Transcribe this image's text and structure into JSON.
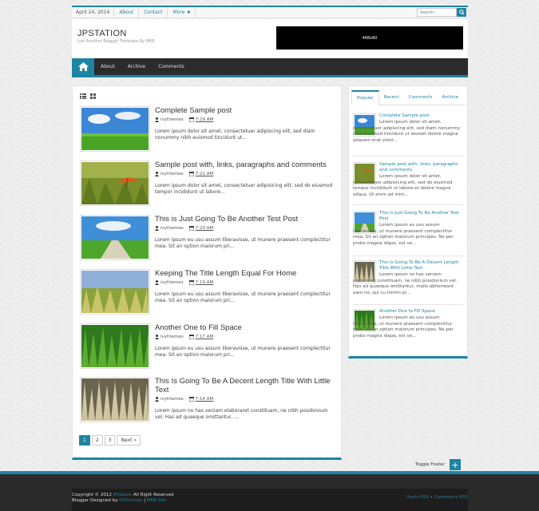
{
  "topbar": {
    "date": "April 24, 2014",
    "links": [
      "About",
      "Contact",
      "More"
    ],
    "search_placeholder": "Search..."
  },
  "header": {
    "logo": "JPSTATION",
    "tagline": "Just Another Blogger Template By MKR",
    "ad_label": "468x60"
  },
  "nav": {
    "items": [
      "About",
      "Archive",
      "Comments"
    ]
  },
  "posts": [
    {
      "title": "Complete Sample post",
      "author": "ivythemes",
      "time": "7:29 AM",
      "excerpt": "Lorem ipsum dolor sit amet, consectetuer adipiscing elit, sed diam nonummy nibh euismod tincidunt ut..."
    },
    {
      "title": "Sample post with, links, paragraphs and comments",
      "author": "ivythemes",
      "time": "7:21 AM",
      "excerpt": "Lorem ipsum dolor sit amet, consectetuer adipisicing elit, sed do eiusmod tempor incididunt ut labore..."
    },
    {
      "title": "This is Just Going To Be Another Test Post",
      "author": "ivythemes",
      "time": "7:20 AM",
      "excerpt": "Lorem ipsum eu usu assum liberavisse, ut munere praesent complectitur mea. Sit an option maiorum pri..."
    },
    {
      "title": "Keeping The Title Length Equal For Home",
      "author": "ivythemes",
      "time": "7:19 AM",
      "excerpt": "Lorem ipsum eu usu assum liberavisse, ut munere praesent complectitur mea. Sit an option maiorum pri..."
    },
    {
      "title": "Another One to Fill Space",
      "author": "ivythemes",
      "time": "7:17 AM",
      "excerpt": "Lorem ipsum eu usu assum liberavisse, ut munere praesent complectitur mea. Sit an option maiorum pri..."
    },
    {
      "title": "This Is Going To Be A Decent Length Title With Little Text",
      "author": "ivythemes",
      "time": "7:14 AM",
      "excerpt": "Lorem ipsum no has veniam elaboraret constituam, ne nibh posidonium vel. Has ad quaeque omittantur, ..."
    }
  ],
  "pager": {
    "pages": [
      "1",
      "2",
      "3"
    ],
    "next": "Next »"
  },
  "sidebar": {
    "tabs": [
      "Popular",
      "Recent",
      "Comments",
      "Archive"
    ],
    "items": [
      {
        "title": "Complete Sample post",
        "text": "Lorem ipsum dolor sit amet, consectetuer adipiscing elit, sed diam nonummy nibh euismod tincidunt ut laoreet dolore magna aliquam erat volut..."
      },
      {
        "title": "Sample post with, links, paragraphs and comments",
        "text": "Lorem ipsum dolor sit amet, consectetuer adipisicing elit, sed do eiusmod tempor incididunt ut labore et dolore magna aliqua. Ut enim ad mini..."
      },
      {
        "title": "This is Just Going To Be Another Test Post",
        "text": "Lorem ipsum eu usu assum liberavisse, ut munere praesent complectitur mea. Sit an option maiorum principes. Ne per probo magna idque, est ve..."
      },
      {
        "title": "This Is Going To Be A Decent Length Title With Little Text",
        "text": "Lorem ipsum no has veniam elaboraret constituam, ne nibh posidonium vel. Has ad quaeque omittantur, malis abhorreant eam no, qui cu minim pl..."
      },
      {
        "title": "Another One to Fill Space",
        "text": "Lorem ipsum eu usu assum liberavisse, ut munere praesent complectitur mea. Sit an option maiorum principes. Ne per probo magna idque, est ve..."
      }
    ]
  },
  "footer": {
    "toggle_label": "Toggle Footer",
    "toggle_symbol": "+",
    "copyright_prefix": "Copyright © 2012",
    "copyright_site": "JPstation",
    "copyright_suffix": "All Right Reserved",
    "designed_prefix": "Blogger Designed by",
    "designer": "IVYthemes",
    "separator": "|",
    "site_link": "MKR Site",
    "posts_rss": "Posts RSS",
    "rss_dot": "•",
    "comments_rss": "Comments RSS"
  },
  "colors": {
    "accent": "#1e84a3",
    "nav_bg": "#2b2b2b",
    "footer_bg": "#2a2a2a"
  }
}
